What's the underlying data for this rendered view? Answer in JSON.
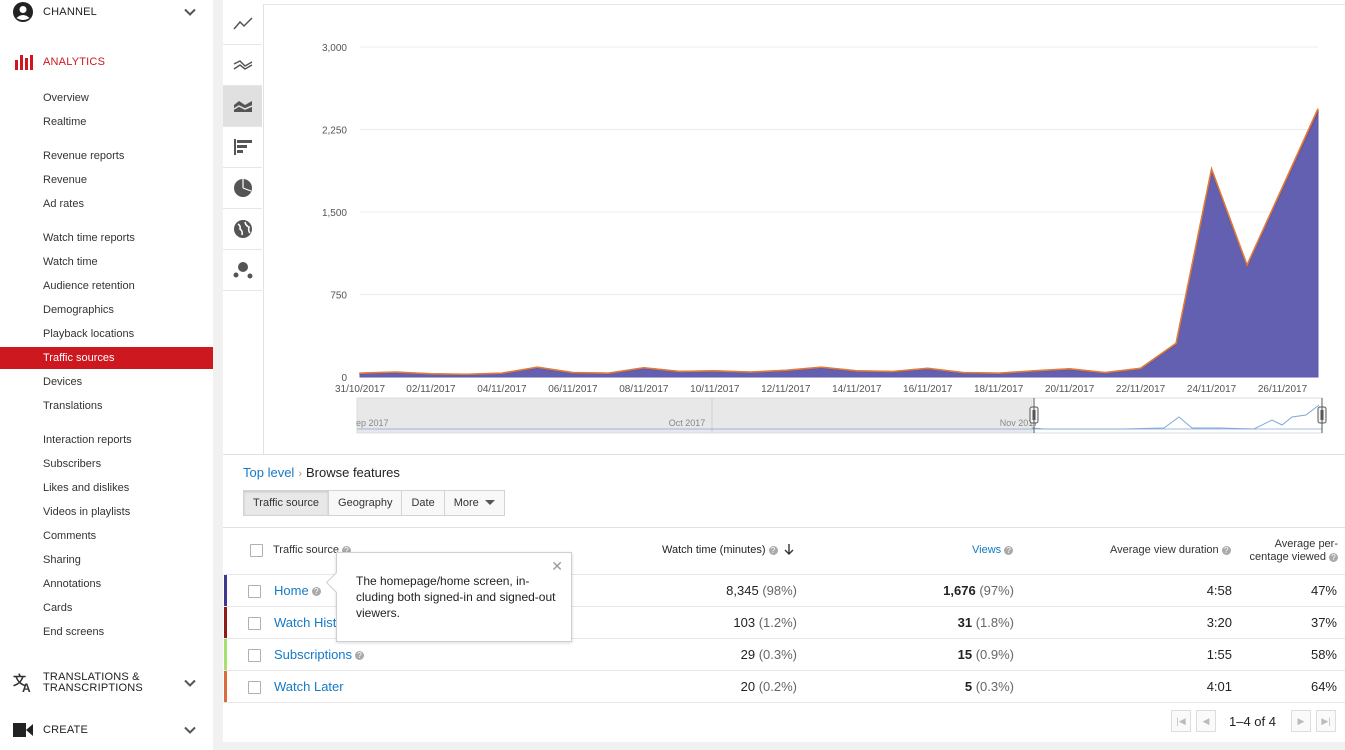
{
  "sidebar": {
    "channel_label": "CHANNEL",
    "analytics_label": "ANALYTICS",
    "translations_label": "TRANSLATIONS & TRANSCRIPTIONS",
    "create_label": "CREATE",
    "items": [
      {
        "label": "Overview"
      },
      {
        "label": "Realtime"
      },
      {
        "label": "Revenue reports"
      },
      {
        "label": "Revenue"
      },
      {
        "label": "Ad rates"
      },
      {
        "label": "Watch time reports"
      },
      {
        "label": "Watch time"
      },
      {
        "label": "Audience retention"
      },
      {
        "label": "Demographics"
      },
      {
        "label": "Playback locations"
      },
      {
        "label": "Traffic sources",
        "active": true
      },
      {
        "label": "Devices"
      },
      {
        "label": "Translations"
      },
      {
        "label": "Interaction reports"
      },
      {
        "label": "Subscribers"
      },
      {
        "label": "Likes and dislikes"
      },
      {
        "label": "Videos in playlists"
      },
      {
        "label": "Comments"
      },
      {
        "label": "Sharing"
      },
      {
        "label": "Annotations"
      },
      {
        "label": "Cards"
      },
      {
        "label": "End screens"
      }
    ]
  },
  "toolbar": {
    "buttons": [
      "line-chart-icon",
      "multi-line-chart-icon",
      "stacked-area-chart-icon",
      "bar-chart-icon",
      "pie-chart-icon",
      "map-globe-icon",
      "bubble-chart-icon"
    ],
    "selected": "stacked-area-chart-icon"
  },
  "chart_data": {
    "type": "area",
    "x": [
      "31/10/2017",
      "01/11/2017",
      "02/11/2017",
      "03/11/2017",
      "04/11/2017",
      "05/11/2017",
      "06/11/2017",
      "07/11/2017",
      "08/11/2017",
      "09/11/2017",
      "10/11/2017",
      "11/11/2017",
      "12/11/2017",
      "13/11/2017",
      "14/11/2017",
      "15/11/2017",
      "16/11/2017",
      "17/11/2017",
      "18/11/2017",
      "19/11/2017",
      "20/11/2017",
      "21/11/2017",
      "22/11/2017",
      "23/11/2017",
      "24/11/2017",
      "25/11/2017",
      "26/11/2017",
      "27/11/2017"
    ],
    "x_tick_labels": [
      "31/10/2017",
      "02/11/2017",
      "04/11/2017",
      "06/11/2017",
      "08/11/2017",
      "10/11/2017",
      "12/11/2017",
      "14/11/2017",
      "16/11/2017",
      "18/11/2017",
      "20/11/2017",
      "22/11/2017",
      "24/11/2017",
      "26/11/2017"
    ],
    "y_tick_labels": [
      "0",
      "750",
      "1,500",
      "2,250",
      "3,000"
    ],
    "ylim": [
      0,
      3000
    ],
    "series": [
      {
        "name": "Home",
        "color": "#5c57ad",
        "values": [
          30,
          40,
          25,
          20,
          30,
          80,
          35,
          30,
          75,
          45,
          50,
          40,
          55,
          80,
          50,
          45,
          70,
          35,
          30,
          50,
          65,
          35,
          70,
          290,
          1860,
          1000,
          1700,
          2400
        ]
      },
      {
        "name": "Watch History",
        "color": "#c0392b",
        "values": [
          3,
          3,
          2,
          2,
          3,
          5,
          3,
          3,
          5,
          4,
          4,
          3,
          4,
          5,
          4,
          3,
          5,
          3,
          3,
          4,
          5,
          3,
          5,
          10,
          20,
          12,
          18,
          25
        ]
      },
      {
        "name": "Subscriptions",
        "color": "#99e050",
        "values": [
          1,
          1,
          1,
          1,
          1,
          2,
          1,
          1,
          2,
          1,
          1,
          1,
          1,
          2,
          1,
          1,
          2,
          1,
          1,
          1,
          2,
          1,
          2,
          3,
          5,
          3,
          4,
          6
        ]
      },
      {
        "name": "Watch Later",
        "color": "#e07b39",
        "values": [
          1,
          1,
          1,
          1,
          1,
          2,
          1,
          1,
          2,
          1,
          1,
          1,
          1,
          2,
          1,
          1,
          2,
          1,
          1,
          1,
          2,
          1,
          2,
          3,
          6,
          3,
          4,
          7
        ]
      }
    ],
    "navigator_labels": [
      "ep 2017",
      "Oct 2017",
      "Nov 2017"
    ],
    "grid": true,
    "legend": "none"
  },
  "breadcrumb": {
    "top": "Top level",
    "current": "Browse features"
  },
  "tabs": [
    {
      "label": "Traffic source",
      "selected": true
    },
    {
      "label": "Geography"
    },
    {
      "label": "Date"
    },
    {
      "label": "More"
    }
  ],
  "table": {
    "headers": {
      "source": "Traffic source",
      "watch_time": "Watch time (minutes)",
      "views": "Views",
      "avg_duration": "Average view duration",
      "avg_pct_1": "Average per-",
      "avg_pct_2": "centage viewed"
    },
    "rows": [
      {
        "name": "Home",
        "color": "#3e3a8f",
        "watch_time": "8,345",
        "watch_pct": "(98%)",
        "views": "1,676",
        "views_pct": "(97%)",
        "duration": "4:58",
        "pct_viewed": "47%"
      },
      {
        "name": "Watch History",
        "color": "#8e1c1c",
        "watch_time": "103",
        "watch_pct": "(1.2%)",
        "views": "31",
        "views_pct": "(1.8%)",
        "duration": "3:20",
        "pct_viewed": "37%"
      },
      {
        "name": "Subscriptions",
        "color": "#a5e070",
        "watch_time": "29",
        "watch_pct": "(0.3%)",
        "views": "15",
        "views_pct": "(0.9%)",
        "duration": "1:55",
        "pct_viewed": "58%"
      },
      {
        "name": "Watch Later",
        "color": "#d96b3f",
        "watch_time": "20",
        "watch_pct": "(0.2%)",
        "views": "5",
        "views_pct": "(0.3%)",
        "duration": "4:01",
        "pct_viewed": "64%"
      }
    ]
  },
  "tooltip": {
    "text": "The homepage/home screen, in-cluding both signed-in and signed-out viewers."
  },
  "pager": {
    "label": "1–4 of 4"
  }
}
